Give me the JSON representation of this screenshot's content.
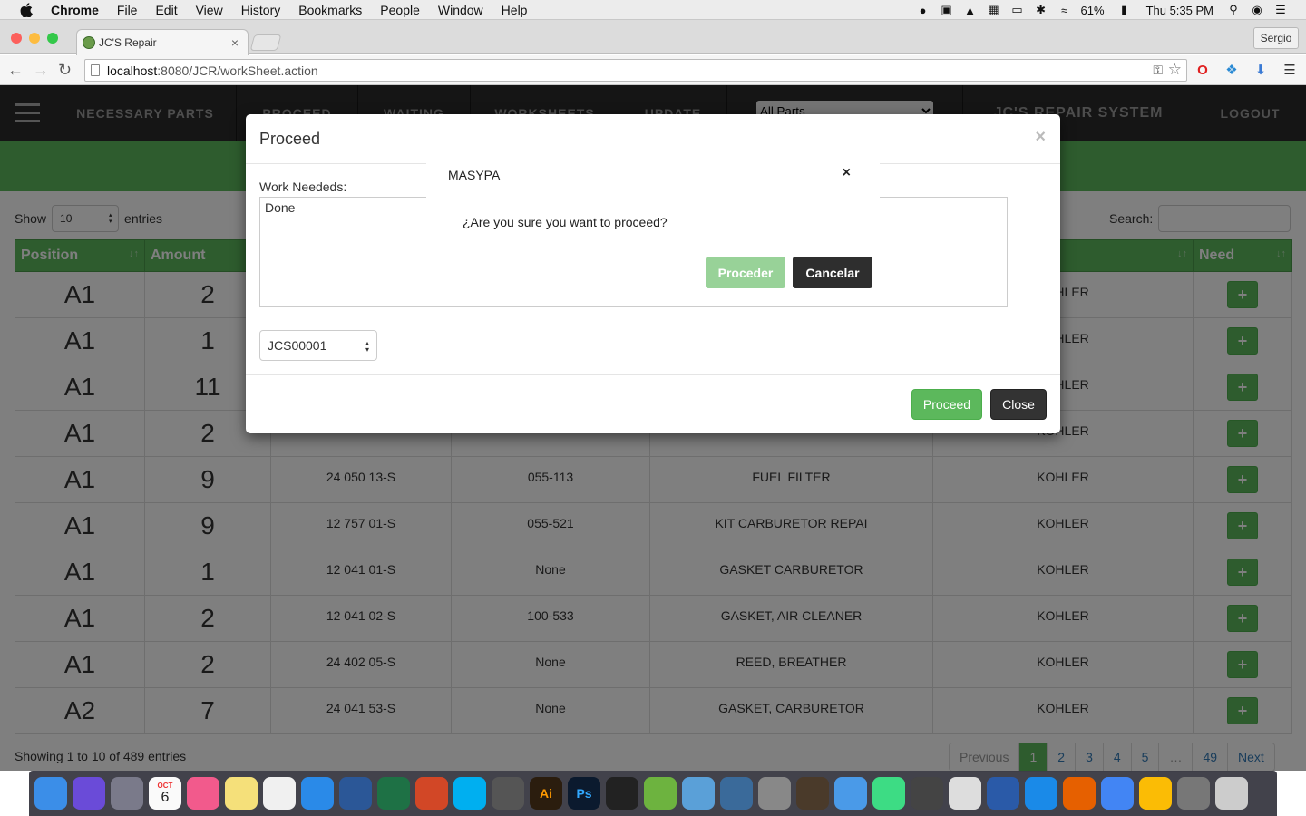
{
  "menubar": {
    "app": "Chrome",
    "items": [
      "File",
      "Edit",
      "View",
      "History",
      "Bookmarks",
      "People",
      "Window",
      "Help"
    ],
    "battery": "61%",
    "clock": "Thu 5:35 PM"
  },
  "browser": {
    "tab_title": "JC'S Repair",
    "user": "Sergio",
    "url_host": "localhost",
    "url_path": ":8080/JCR/workSheet.action"
  },
  "nav": {
    "items": [
      "NECESSARY PARTS",
      "PROCEED",
      "WAITING",
      "WORKSHEETS",
      "UPDATE"
    ],
    "select_value": "All Parts",
    "brand": "JC'S REPAIR SYSTEM",
    "logout": "LOGOUT"
  },
  "table": {
    "show_label": "Show",
    "entries_value": "10",
    "entries_label": "entries",
    "search_label": "Search:",
    "columns": [
      "Position",
      "Amount",
      "",
      "",
      "",
      "",
      "Need"
    ],
    "rows": [
      {
        "position": "A1",
        "amount": "2",
        "part": "",
        "alt": "",
        "desc": "",
        "brand": "KOHLER"
      },
      {
        "position": "A1",
        "amount": "1",
        "part": "",
        "alt": "",
        "desc": "",
        "brand": "KOHLER"
      },
      {
        "position": "A1",
        "amount": "11",
        "part": "",
        "alt": "",
        "desc": "",
        "brand": "KOHLER"
      },
      {
        "position": "A1",
        "amount": "2",
        "part": "",
        "alt": "",
        "desc": "",
        "brand": "KOHLER"
      },
      {
        "position": "A1",
        "amount": "9",
        "part": "24 050 13-S",
        "alt": "055-113",
        "desc": "FUEL FILTER",
        "brand": "KOHLER"
      },
      {
        "position": "A1",
        "amount": "9",
        "part": "12 757 01-S",
        "alt": "055-521",
        "desc": "KIT CARBURETOR REPAI",
        "brand": "KOHLER"
      },
      {
        "position": "A1",
        "amount": "1",
        "part": "12 041 01-S",
        "alt": "None",
        "desc": "GASKET CARBURETOR",
        "brand": "KOHLER"
      },
      {
        "position": "A1",
        "amount": "2",
        "part": "12 041 02-S",
        "alt": "100-533",
        "desc": "GASKET, AIR CLEANER",
        "brand": "KOHLER"
      },
      {
        "position": "A1",
        "amount": "2",
        "part": "24 402 05-S",
        "alt": "None",
        "desc": "REED, BREATHER",
        "brand": "KOHLER"
      },
      {
        "position": "A2",
        "amount": "7",
        "part": "24 041 53-S",
        "alt": "None",
        "desc": "GASKET, CARBURETOR",
        "brand": "KOHLER"
      }
    ],
    "plus_label": "+",
    "showing": "Showing 1 to 10 of 489 entries",
    "pager": {
      "prev": "Previous",
      "pages": [
        "1",
        "2",
        "3",
        "4",
        "5",
        "…",
        "49"
      ],
      "next": "Next"
    }
  },
  "proceed_modal": {
    "title": "Proceed",
    "close_x": "×",
    "work_label": "Work Neededs:",
    "work_value": "Done",
    "worksheet_value": "JCS00001",
    "proceed_btn": "Proceed",
    "close_btn": "Close"
  },
  "confirm_modal": {
    "title": "MASYPA",
    "close_x": "×",
    "question": "¿Are you sure you want to proceed?",
    "ok_btn": "Proceder",
    "cancel_btn": "Cancelar"
  },
  "colors": {
    "green": "#5cb85c",
    "nav": "#2b2b2b",
    "dark_btn": "#333333"
  },
  "dock": {
    "apps": [
      "finder-icon",
      "siri-icon",
      "launchpad-icon",
      "calendar-icon",
      "itunes-icon",
      "notes-icon",
      "textedit-icon",
      "appstore-icon",
      "word-icon",
      "excel-icon",
      "powerpoint-icon",
      "skype-icon",
      "instruments-icon",
      "illustrator-icon",
      "photoshop-icon",
      "terminal-icon",
      "spring-icon",
      "virtualbox-icon",
      "mysql-icon",
      "sequelpro-icon",
      "sublime-icon",
      "xcode-icon",
      "android-studio-icon",
      "tool-icon",
      "preview-icon",
      "netbeans-icon",
      "safari-icon",
      "firefox-icon",
      "chrome-icon",
      "drive-icon",
      "settings-icon",
      "trash-icon"
    ],
    "ai_label": "Ai",
    "ps_label": "Ps",
    "calendar_month": "OCT",
    "calendar_day": "6"
  }
}
